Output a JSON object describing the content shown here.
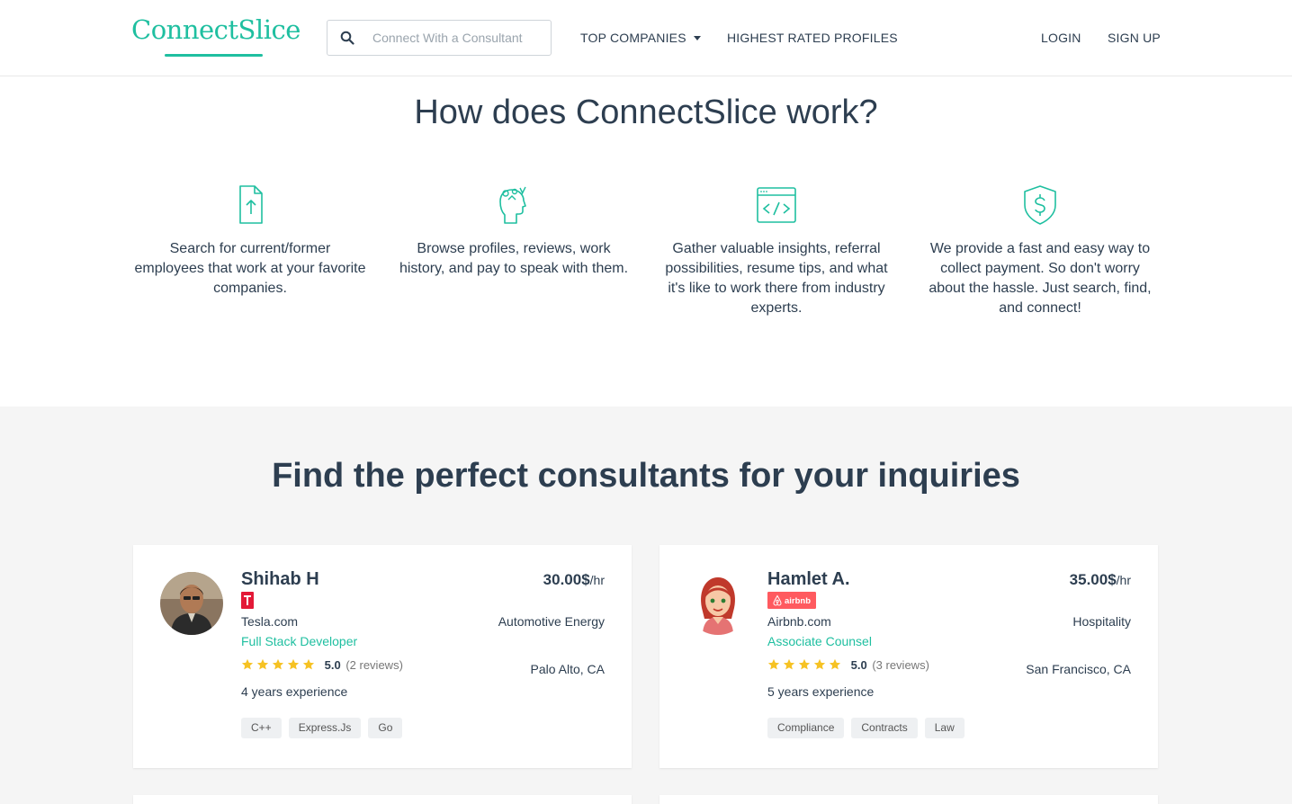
{
  "header": {
    "logo": "ConnectSlice",
    "search_placeholder": "Connect With a Consultant",
    "nav": {
      "top_companies": "TOP COMPANIES",
      "highest_rated": "HIGHEST RATED PROFILES",
      "login": "LOGIN",
      "signup": "SIGN UP"
    }
  },
  "how": {
    "title": "How does ConnectSlice work?",
    "steps": [
      {
        "icon": "upload-document-icon",
        "text": "Search for current/former employees that work at your favorite companies."
      },
      {
        "icon": "head-ideas-icon",
        "text": "Browse profiles, reviews, work history, and pay to speak with them."
      },
      {
        "icon": "code-window-icon",
        "text": "Gather valuable insights, referral possibilities, resume tips, and what it's like to work there from industry experts."
      },
      {
        "icon": "shield-dollar-icon",
        "text": "We provide a fast and easy way to collect payment. So don't worry about the hassle. Just search, find, and connect!"
      }
    ]
  },
  "consultants": {
    "title": "Find the perfect consultants for your inquiries",
    "cards": [
      {
        "name": "Shihab H",
        "company": "Tesla.com",
        "badge": "tesla-logo",
        "role": "Full Stack Developer",
        "rating": "5.0",
        "reviews": "(2 reviews)",
        "experience": "4 years experience",
        "rate": "30.00$",
        "rate_unit": "/hr",
        "industry": "Automotive Energy",
        "location": "Palo Alto, CA",
        "tags": [
          "C++",
          "Express.Js",
          "Go"
        ]
      },
      {
        "name": "Hamlet A.",
        "company": "Airbnb.com",
        "badge": "airbnb",
        "role": "Associate Counsel",
        "rating": "5.0",
        "reviews": "(3 reviews)",
        "experience": "5 years experience",
        "rate": "35.00$",
        "rate_unit": "/hr",
        "industry": "Hospitality",
        "location": "San Francisco, CA",
        "tags": [
          "Compliance",
          "Contracts",
          "Law"
        ]
      }
    ]
  },
  "colors": {
    "accent": "#1fbfa0",
    "text": "#2d3e50",
    "star": "#f6c223",
    "tesla_red": "#e31937",
    "airbnb_red": "#ff5a5f",
    "section_bg": "#f5f5f5"
  }
}
